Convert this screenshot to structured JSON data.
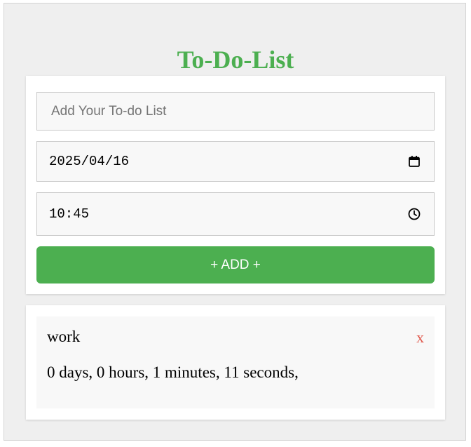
{
  "app": {
    "title": "To-Do-List"
  },
  "form": {
    "task_placeholder": "Add Your To-do List",
    "date_value": "2025/04/16",
    "time_value": "10:45",
    "add_label": "+ ADD +",
    "date_icon": "calendar-icon",
    "time_icon": "clock-icon"
  },
  "todos": [
    {
      "name": "work",
      "countdown": "0 days, 0 hours, 1 minutes, 11 seconds,",
      "delete_label": "x"
    }
  ],
  "colors": {
    "accent": "#4caf50",
    "delete": "#e0574b",
    "background": "#efefef",
    "card": "#ffffff",
    "field": "#f8f8f8"
  }
}
